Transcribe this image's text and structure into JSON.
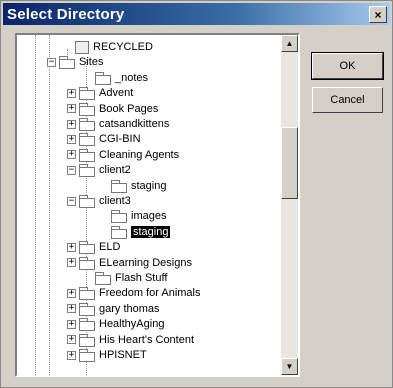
{
  "window": {
    "title": "Select Directory",
    "close_glyph": "×"
  },
  "buttons": {
    "ok_label": "OK",
    "cancel_label": "Cancel"
  },
  "tree": {
    "items": [
      {
        "label": "RECYCLED",
        "icon": "recycle-bin-icon",
        "expander": ""
      },
      {
        "label": "Sites",
        "icon": "folder-icon",
        "expander": "−"
      },
      {
        "label": "_notes",
        "icon": "folder-icon",
        "expander": ""
      },
      {
        "label": "Advent",
        "icon": "folder-icon",
        "expander": "+"
      },
      {
        "label": "Book Pages",
        "icon": "folder-icon",
        "expander": "+"
      },
      {
        "label": "catsandkittens",
        "icon": "folder-icon",
        "expander": "+"
      },
      {
        "label": "CGI-BIN",
        "icon": "folder-icon",
        "expander": "+"
      },
      {
        "label": "Cleaning Agents",
        "icon": "folder-icon",
        "expander": "+"
      },
      {
        "label": "client2",
        "icon": "folder-icon",
        "expander": "−"
      },
      {
        "label": "staging",
        "icon": "folder-icon",
        "expander": ""
      },
      {
        "label": "client3",
        "icon": "folder-icon",
        "expander": "−"
      },
      {
        "label": "images",
        "icon": "folder-icon",
        "expander": ""
      },
      {
        "label": "staging",
        "icon": "folder-icon",
        "expander": "",
        "selected": true
      },
      {
        "label": "ELD",
        "icon": "folder-icon",
        "expander": "+"
      },
      {
        "label": "ELearning Designs",
        "icon": "folder-icon",
        "expander": "+"
      },
      {
        "label": "Flash Stuff",
        "icon": "folder-icon",
        "expander": ""
      },
      {
        "label": "Freedom for Animals",
        "icon": "folder-icon",
        "expander": "+"
      },
      {
        "label": "gary thomas",
        "icon": "folder-icon",
        "expander": "+"
      },
      {
        "label": "HealthyAging",
        "icon": "folder-icon",
        "expander": "+"
      },
      {
        "label": "His Heart's Content",
        "icon": "folder-icon",
        "expander": "+"
      },
      {
        "label": "HPISNET",
        "icon": "folder-icon",
        "expander": "+"
      }
    ]
  },
  "scrollbar": {
    "up_glyph": "▲",
    "down_glyph": "▼"
  }
}
